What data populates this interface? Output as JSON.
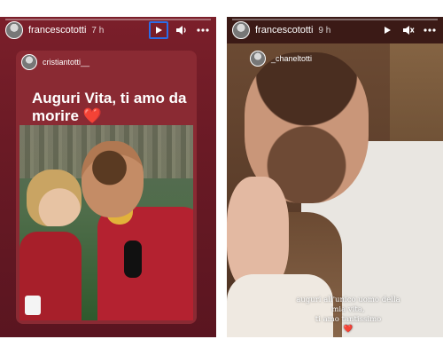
{
  "stories": [
    {
      "username": "francescototti",
      "timestamp": "7 h",
      "repost": {
        "username": "cristiantotti__",
        "caption": "Auguri Vita, ti amo da morire",
        "caption_emoji": "❤️"
      },
      "controls": [
        "play-icon",
        "volume-icon",
        "more-icon"
      ]
    },
    {
      "username": "francescototti",
      "timestamp": "9 h",
      "tagged_username": "_chaneltotti",
      "overlay_lines": [
        "auguri all'unico uomo della",
        "mia vita,",
        "ti amo tantissimo"
      ],
      "overlay_emoji": "❤️",
      "controls": [
        "play-icon",
        "mute-icon",
        "more-icon"
      ]
    }
  ],
  "colors": {
    "accent_highlight": "#2b6de8",
    "story_left_bg": "#7b1f2a",
    "heart": "#e8304a"
  }
}
